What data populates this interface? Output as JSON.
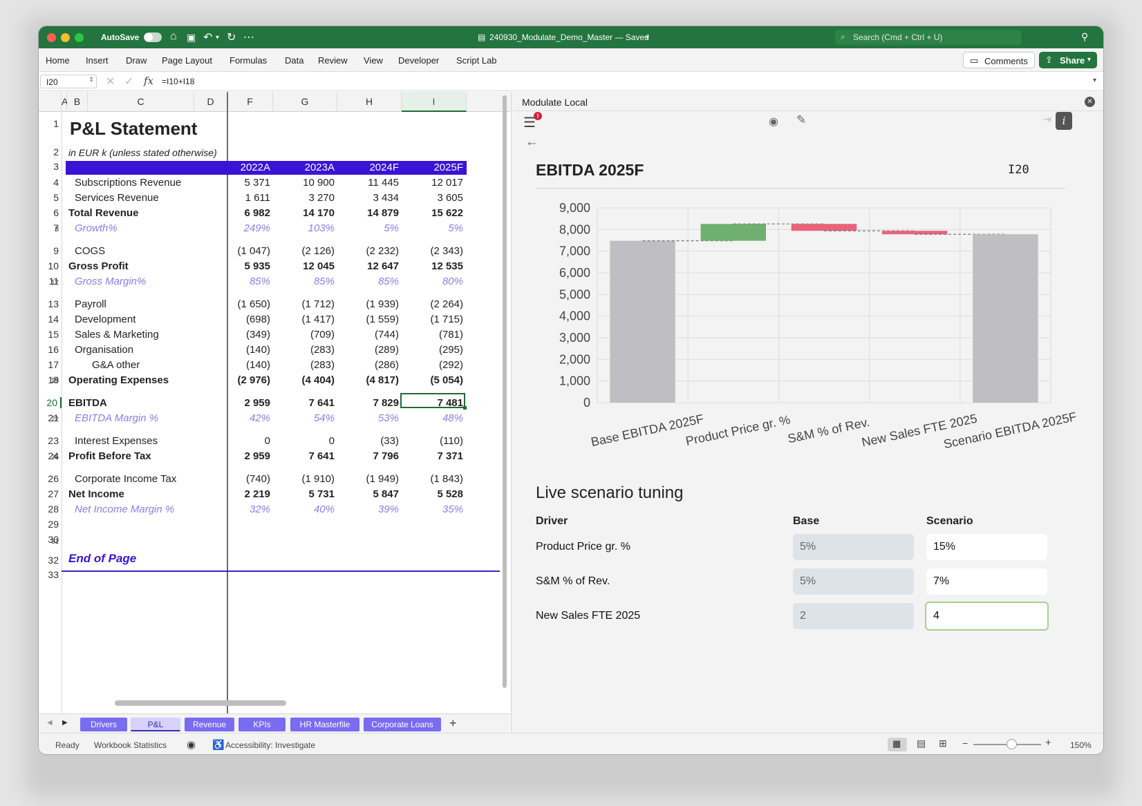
{
  "window": {
    "title": "240930_Modulate_Demo_Master — Saved",
    "autosave": "AutoSave",
    "search_placeholder": "Search (Cmd + Ctrl + U)"
  },
  "ribbon": {
    "tabs": [
      "Home",
      "Insert",
      "Draw",
      "Page Layout",
      "Formulas",
      "Data",
      "Review",
      "View",
      "Developer",
      "Script Lab"
    ],
    "comments": "Comments",
    "share": "Share"
  },
  "formula_bar": {
    "cell_ref": "I20",
    "formula": "=I10+I18"
  },
  "sheet": {
    "title": "P&L Statement",
    "subtitle": "in EUR k (unless stated otherwise)",
    "columns": [
      "A",
      "B",
      "C",
      "D",
      "F",
      "G",
      "H",
      "I"
    ],
    "year_headers": [
      "2022A",
      "2023A",
      "2024F",
      "2025F"
    ],
    "rows": [
      {
        "n": "4",
        "label": "Subscriptions Revenue",
        "style": "normal",
        "v": [
          "5 371",
          "10 900",
          "11 445",
          "12 017"
        ]
      },
      {
        "n": "5",
        "label": "Services Revenue",
        "style": "normal",
        "v": [
          "1 611",
          "3 270",
          "3 434",
          "3 605"
        ]
      },
      {
        "n": "6",
        "label": "Total Revenue",
        "style": "bold",
        "v": [
          "6 982",
          "14 170",
          "14 879",
          "15 622"
        ]
      },
      {
        "n": "7",
        "label": "Growth%",
        "style": "pct",
        "v": [
          "249%",
          "103%",
          "5%",
          "5%"
        ]
      },
      {
        "n": "9",
        "label": "COGS",
        "style": "normal",
        "v": [
          "(1 047)",
          "(2 126)",
          "(2 232)",
          "(2 343)"
        ]
      },
      {
        "n": "10",
        "label": "Gross Profit",
        "style": "bold",
        "v": [
          "5 935",
          "12 045",
          "12 647",
          "12 535"
        ]
      },
      {
        "n": "11",
        "label": "Gross Margin%",
        "style": "pct",
        "v": [
          "85%",
          "85%",
          "85%",
          "80%"
        ]
      },
      {
        "n": "13",
        "label": "Payroll",
        "style": "normal",
        "v": [
          "(1 650)",
          "(1 712)",
          "(1 939)",
          "(2 264)"
        ]
      },
      {
        "n": "14",
        "label": "Development",
        "style": "normal",
        "v": [
          "(698)",
          "(1 417)",
          "(1 559)",
          "(1 715)"
        ]
      },
      {
        "n": "15",
        "label": "Sales & Marketing",
        "style": "normal",
        "v": [
          "(349)",
          "(709)",
          "(744)",
          "(781)"
        ]
      },
      {
        "n": "16",
        "label": "Organisation",
        "style": "normal",
        "v": [
          "(140)",
          "(283)",
          "(289)",
          "(295)"
        ]
      },
      {
        "n": "17",
        "label": "G&A other",
        "style": "indent2",
        "v": [
          "(140)",
          "(283)",
          "(286)",
          "(292)"
        ]
      },
      {
        "n": "18",
        "label": "Operating Expenses",
        "style": "bold",
        "v": [
          "(2 976)",
          "(4 404)",
          "(4 817)",
          "(5 054)"
        ]
      },
      {
        "n": "20",
        "label": "EBITDA",
        "style": "bold",
        "v": [
          "2 959",
          "7 641",
          "7 829",
          "7 481"
        ]
      },
      {
        "n": "21",
        "label": "EBITDA Margin %",
        "style": "pct",
        "v": [
          "42%",
          "54%",
          "53%",
          "48%"
        ]
      },
      {
        "n": "23",
        "label": "Interest Expenses",
        "style": "normal",
        "v": [
          "0",
          "0",
          "(33)",
          "(110)"
        ]
      },
      {
        "n": "24",
        "label": "Profit Before Tax",
        "style": "bold",
        "v": [
          "2 959",
          "7 641",
          "7 796",
          "7 371"
        ]
      },
      {
        "n": "26",
        "label": "Corporate Income Tax",
        "style": "normal",
        "v": [
          "(740)",
          "(1 910)",
          "(1 949)",
          "(1 843)"
        ]
      },
      {
        "n": "27",
        "label": "Net Income",
        "style": "bold",
        "v": [
          "2 219",
          "5 731",
          "5 847",
          "5 528"
        ]
      },
      {
        "n": "28",
        "label": "Net Income Margin %",
        "style": "pct",
        "v": [
          "32%",
          "40%",
          "39%",
          "35%"
        ]
      }
    ],
    "end_of_page": "End of Page",
    "tabs": [
      "Drivers",
      "P&L",
      "Revenue",
      "KPIs",
      "HR Masterfile",
      "Corporate Loans"
    ],
    "add_tab": "+"
  },
  "status": {
    "ready": "Ready",
    "workbook_stats": "Workbook Statistics",
    "accessibility": "Accessibility: Investigate",
    "zoom": "150%"
  },
  "panel": {
    "header": "Modulate Local",
    "chart_title": "EBITDA 2025F",
    "cell_ref": "I20",
    "tuning_title": "Live scenario tuning",
    "col_driver": "Driver",
    "col_base": "Base",
    "col_scenario": "Scenario",
    "drivers": [
      {
        "label": "Product Price gr. %",
        "base": "5%",
        "scenario": "15%"
      },
      {
        "label": "S&M % of Rev.",
        "base": "5%",
        "scenario": "7%"
      },
      {
        "label": "New Sales FTE 2025",
        "base": "2",
        "scenario": "4"
      }
    ]
  },
  "chart_data": {
    "type": "bar",
    "subtype": "waterfall",
    "title": "",
    "categories": [
      "Base EBITDA 2025F",
      "Product Price gr. %",
      "S&M % of Rev.",
      "New Sales FTE 2025",
      "Scenario EBITDA 2025F"
    ],
    "bars": [
      {
        "start": 0,
        "end": 7481,
        "kind": "total"
      },
      {
        "start": 7481,
        "end": 8260,
        "kind": "increase"
      },
      {
        "start": 8260,
        "end": 7940,
        "kind": "decrease"
      },
      {
        "start": 7940,
        "end": 7780,
        "kind": "decrease"
      },
      {
        "start": 0,
        "end": 7780,
        "kind": "total"
      }
    ],
    "ylim": [
      0,
      9000
    ],
    "yticks": [
      "0",
      "1,000",
      "2,000",
      "3,000",
      "4,000",
      "5,000",
      "6,000",
      "7,000",
      "8,000",
      "9,000"
    ],
    "grid": true,
    "colors": {
      "total": "#bfbfc3",
      "increase": "#6fb071",
      "decrease": "#e8647a"
    }
  }
}
